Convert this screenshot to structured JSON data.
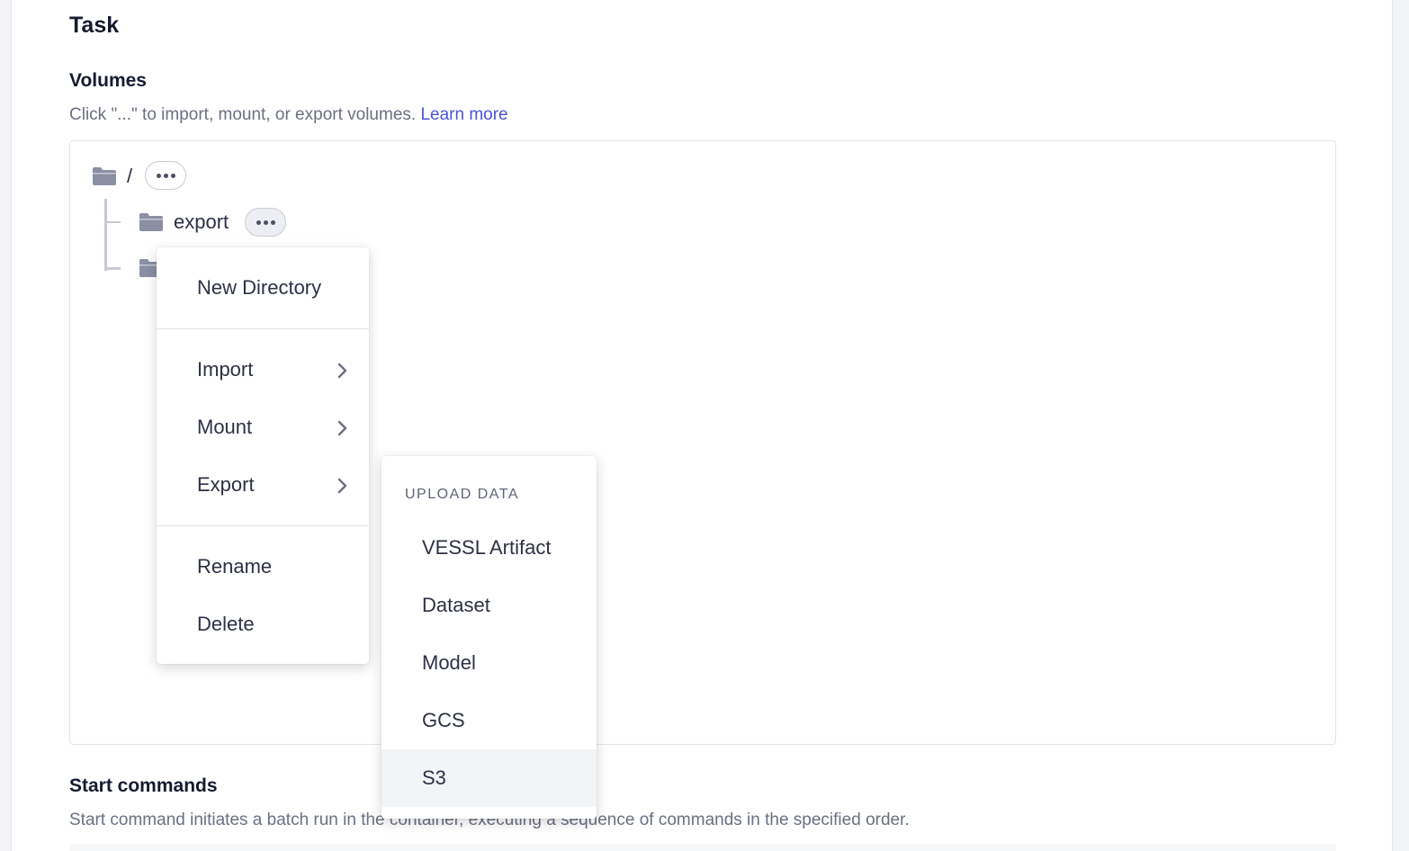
{
  "section": {
    "title": "Task"
  },
  "volumes": {
    "label": "Volumes",
    "help_text": "Click \"...\" to import, mount, or export volumes. ",
    "learn_more": "Learn more",
    "root": {
      "label": "/"
    },
    "children": [
      {
        "label": "export"
      }
    ]
  },
  "context_menu": {
    "new_directory": "New Directory",
    "import": "Import",
    "mount": "Mount",
    "export": "Export",
    "rename": "Rename",
    "delete": "Delete"
  },
  "submenu": {
    "heading": "UPLOAD DATA",
    "items": [
      "VESSL Artifact",
      "Dataset",
      "Model",
      "GCS",
      "S3"
    ],
    "highlighted": "S3"
  },
  "start_commands": {
    "label": "Start commands",
    "help_text": "Start command initiates a batch run in the container, executing a sequence of commands in the specified order."
  },
  "colors": {
    "accent_link": "#4a55d6",
    "folder_icon": "#8a8fa3",
    "text_primary": "#161a2e",
    "text_muted": "#6b7082"
  }
}
